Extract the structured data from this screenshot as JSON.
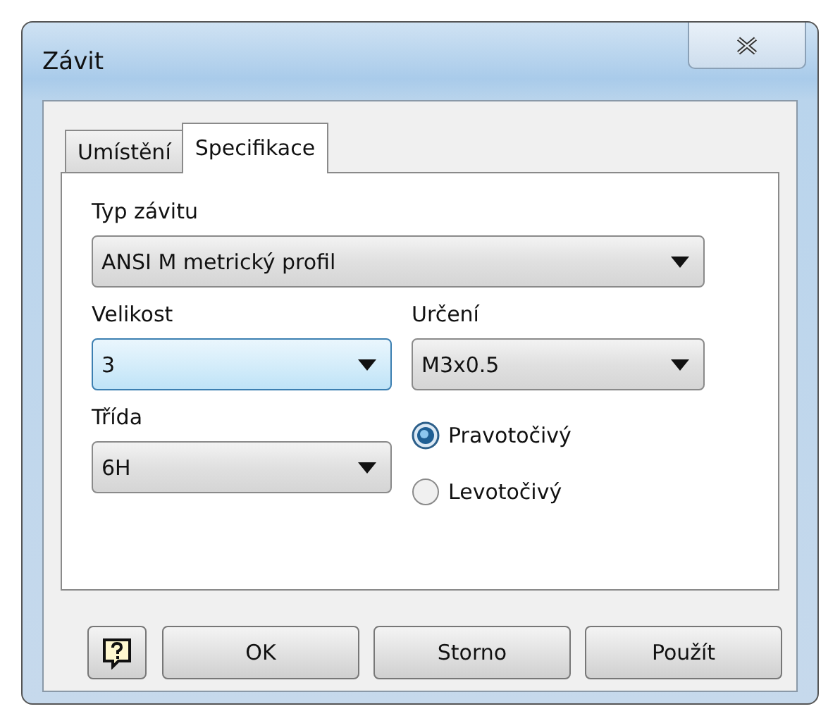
{
  "window": {
    "title": "Závit"
  },
  "tabs": [
    {
      "label": "Umístění",
      "selected": false
    },
    {
      "label": "Specifikace",
      "selected": true
    }
  ],
  "thread_type": {
    "label": "Typ závitu",
    "value": "ANSI M metrický profil",
    "focused": false
  },
  "size": {
    "label": "Velikost",
    "value": "3",
    "focused": true
  },
  "designation": {
    "label": "Určení",
    "value": "M3x0.5",
    "focused": false
  },
  "class": {
    "label": "Třída",
    "value": "6H",
    "focused": false
  },
  "direction": [
    {
      "label": "Pravotočivý",
      "selected": true
    },
    {
      "label": "Levotočivý",
      "selected": false
    }
  ],
  "buttons": [
    "OK",
    "Storno",
    "Použít"
  ]
}
